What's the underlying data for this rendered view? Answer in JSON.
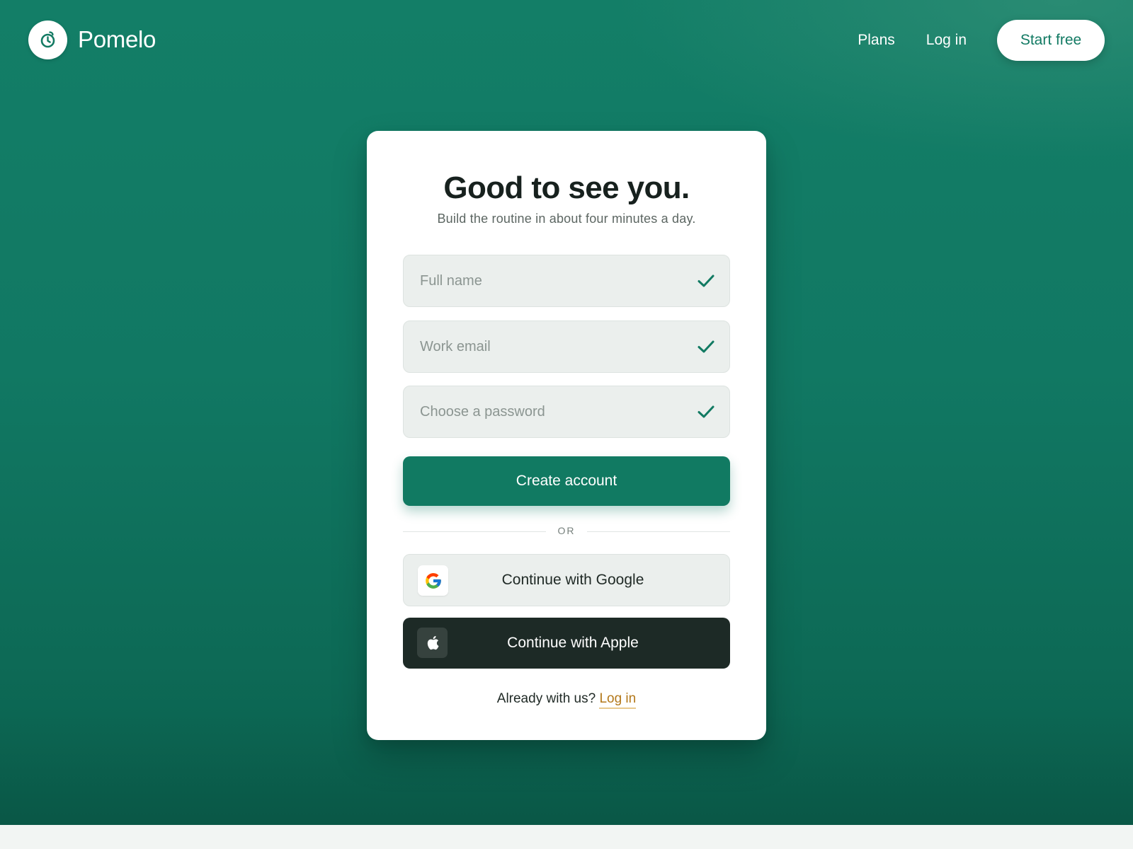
{
  "nav": {
    "brand": "Pomelo",
    "links": [
      "Plans",
      "Log in"
    ],
    "cta": "Start free"
  },
  "card": {
    "title": "Good to see you.",
    "subtitle": "Build the routine in about four minutes a day.",
    "fields": [
      {
        "placeholder": "Full name",
        "valid": true,
        "type": "text"
      },
      {
        "placeholder": "Work email",
        "valid": true,
        "type": "email"
      },
      {
        "placeholder": "Choose a password",
        "valid": true,
        "type": "password"
      }
    ],
    "primary_button": "Create account",
    "divider": "OR",
    "google_button": "Continue with Google",
    "apple_button": "Continue with Apple",
    "footer_text": "Already with us?",
    "footer_link": "Log in"
  },
  "icons": {
    "brand": "stopwatch-icon",
    "field_status": "check-icon",
    "google": "google-icon",
    "apple": "apple-icon"
  },
  "colors": {
    "brand_green": "#117a62",
    "background_green": "#137e67",
    "link_amber": "#b3781a",
    "apple_dark": "#1d2a26"
  }
}
